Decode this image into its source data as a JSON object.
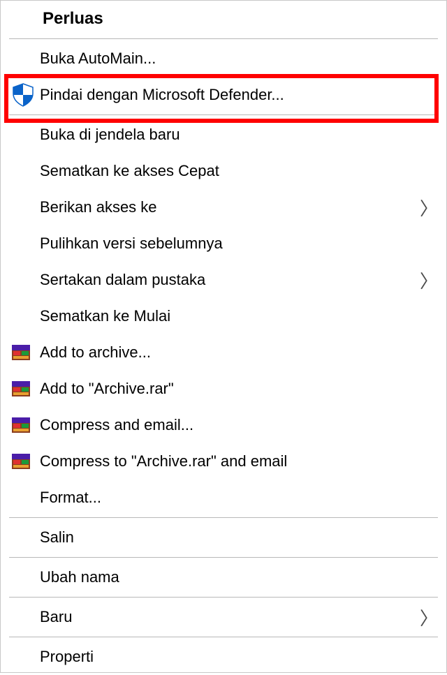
{
  "title": "Perluas",
  "items": {
    "automain": "Buka AutoMain...",
    "defender": "Pindai dengan Microsoft Defender...",
    "new_window": "Buka di jendela baru",
    "pin_quick": "Sematkan ke akses Cepat",
    "give_access": "Berikan akses ke",
    "restore_versions": "Pulihkan versi sebelumnya",
    "include_library": "Sertakan dalam pustaka",
    "pin_start": "Sematkan ke Mulai",
    "add_archive": "Add to archive...",
    "add_archive_rar": "Add to \"Archive.rar\"",
    "compress_email": "Compress and email...",
    "compress_rar_email": "Compress to \"Archive.rar\" and email",
    "format": "Format...",
    "copy": "Salin",
    "rename": "Ubah nama",
    "new": "Baru",
    "properties": "Properti"
  },
  "chevron_glyph": "〉"
}
